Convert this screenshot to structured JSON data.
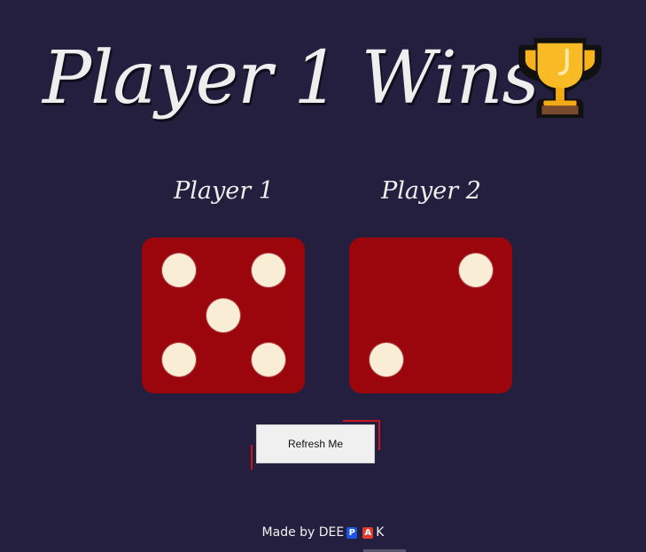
{
  "title": {
    "text": "Player 1 Wins",
    "trophy_icon": "trophy-icon"
  },
  "players": [
    {
      "label": "Player 1",
      "die_value": 5
    },
    {
      "label": "Player 2",
      "die_value": 2
    }
  ],
  "refresh_button": {
    "label": "Refresh Me"
  },
  "footer": {
    "prefix": "Made by DEE",
    "boxed_letter_1": "P",
    "boxed_letter_2": "A",
    "suffix": "K"
  },
  "colors": {
    "background": "#241f3e",
    "die": "#9a060c",
    "pip": "#faedd6",
    "accent": "#c6151f"
  }
}
